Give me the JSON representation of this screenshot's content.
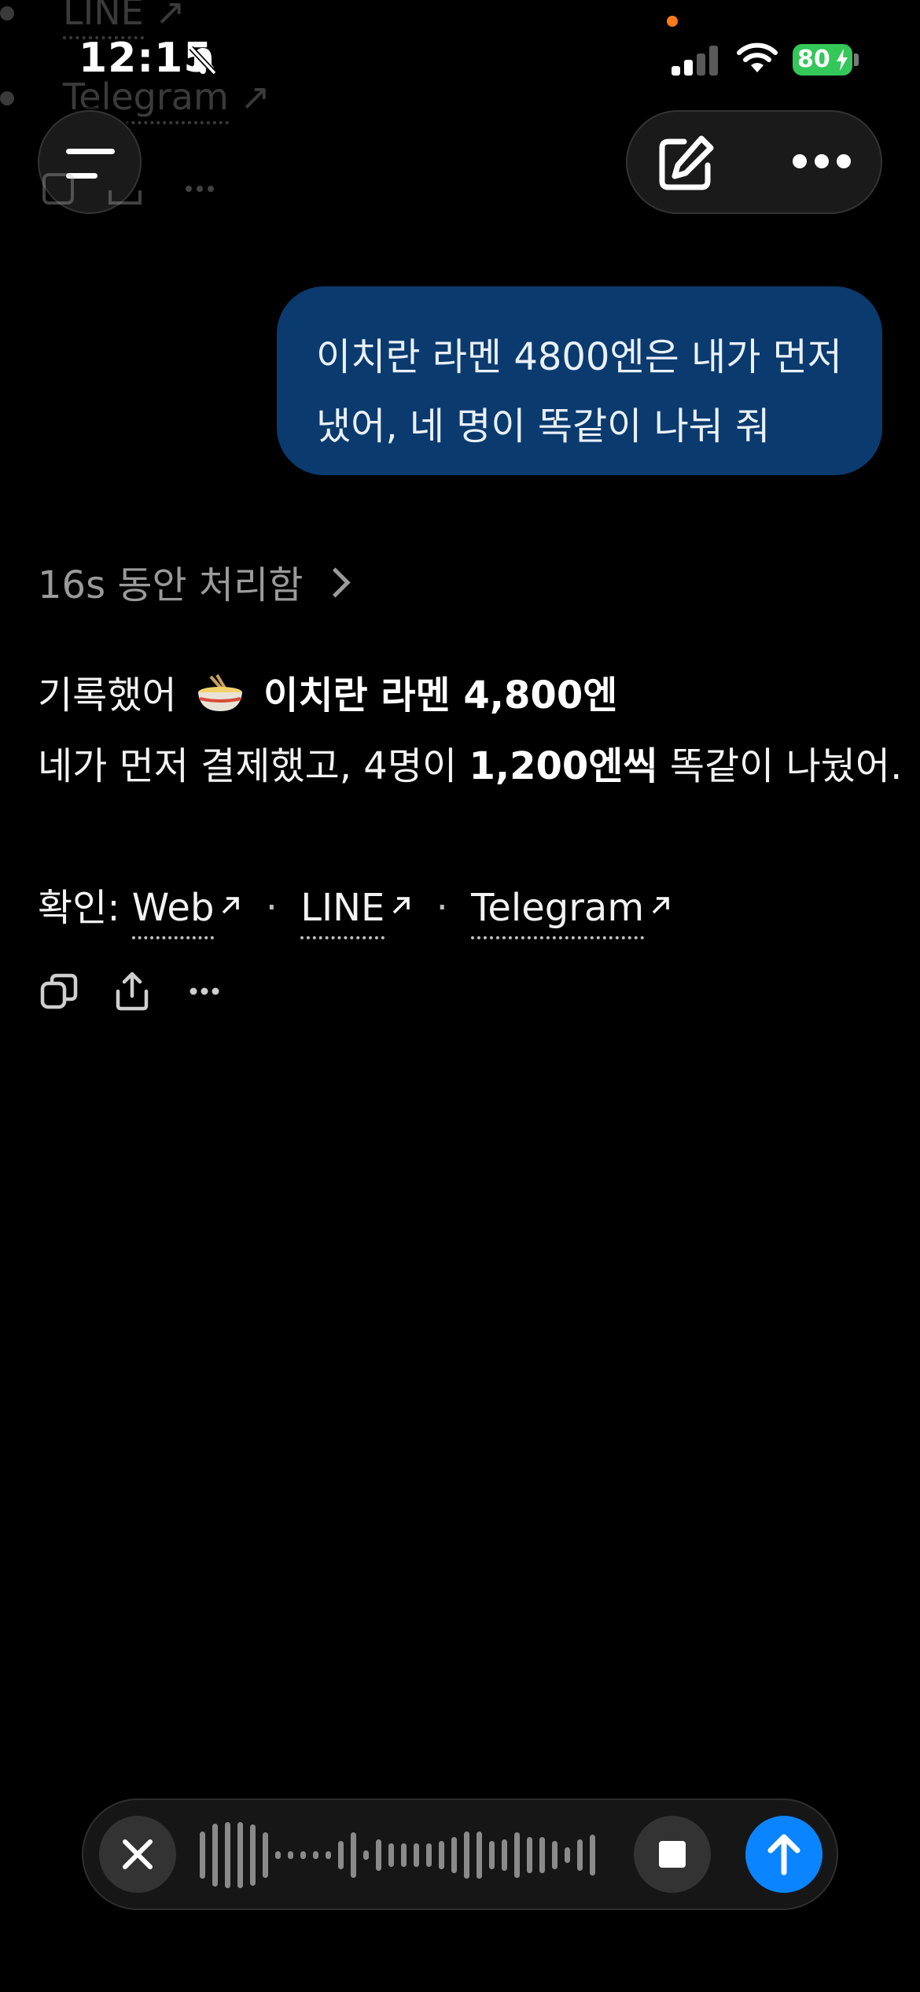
{
  "ghost_list": [
    "LINE",
    "Telegram"
  ],
  "status_bar": {
    "time": "12:15",
    "battery": "80",
    "battery_color": "#34c759"
  },
  "header": {
    "menu_icon": "hamburger-icon",
    "compose_icon": "compose-icon",
    "more_icon": "ellipsis-icon"
  },
  "conversation": {
    "user_message_line1": "이치란 라멘 4800엔은 내가 먼저",
    "user_message_line2": "냈어, 네 명이 똑같이 나눠 줘",
    "thinking_label": "16s 동안 처리함",
    "answer": {
      "line1_prefix": "기록했어",
      "line1_emoji": "ramen-bowl-emoji",
      "line1_bold": "이치란 라멘 4,800엔",
      "line2_prefix": "네가 먼저 결제했고, 4명이",
      "line2_bold": "1,200엔씩",
      "line2_suffix": "똑같이 나눴어."
    },
    "confirm_label": "확인:",
    "links": [
      "Web",
      "LINE",
      "Telegram"
    ],
    "separator": "·"
  },
  "voice_input": {
    "cancel_icon": "close-icon",
    "stop_icon": "stop-icon",
    "send_icon": "arrow-up-icon",
    "accent_color": "#0a84ff"
  },
  "colors": {
    "background": "#000000",
    "bubble": "#0b3a6e"
  }
}
